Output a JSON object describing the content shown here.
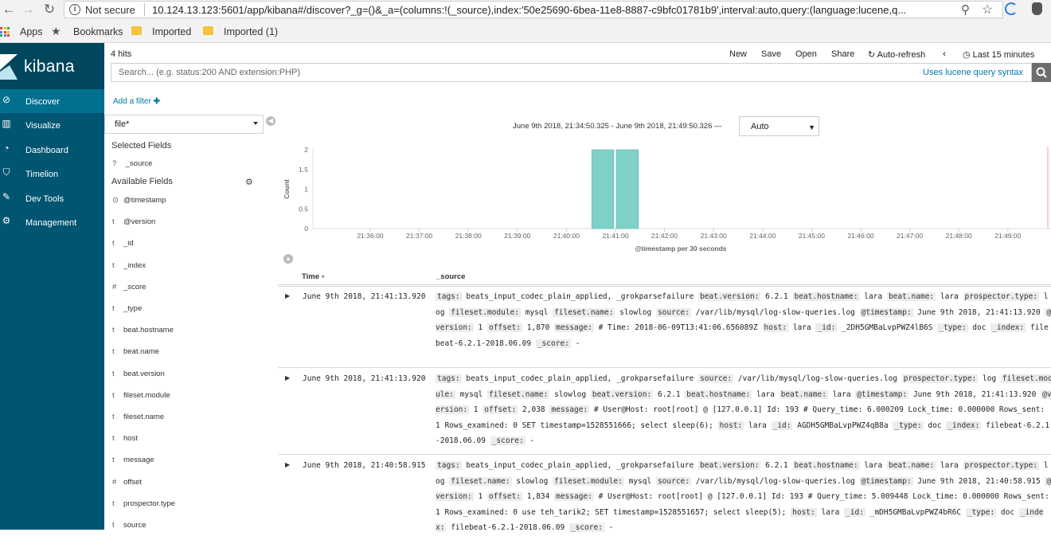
{
  "browser": {
    "not_secure": "Not secure",
    "url": "10.124.13.123:5601/app/kibana#/discover?_g=()&_a=(columns:!(_source),index:'50e25690-6bea-11e8-8887-c9bfc01781b9',interval:auto,query:(language:lucene,q...",
    "bookmarks": [
      "Apps",
      "Bookmarks",
      "Imported",
      "Imported (1)"
    ]
  },
  "kibana": {
    "logo": "kibana",
    "nav": [
      "Discover",
      "Visualize",
      "Dashboard",
      "Timelion",
      "Dev Tools",
      "Management"
    ],
    "active_nav": "Discover"
  },
  "top": {
    "hits": "4 hits",
    "actions": [
      "New",
      "Save",
      "Open",
      "Share",
      "Auto-refresh",
      "Last 15 minutes"
    ]
  },
  "search": {
    "placeholder": "Search... (e.g. status:200 AND extension:PHP)",
    "syntax_link": "Uses lucene query syntax"
  },
  "add_filter": "Add a filter",
  "index_pattern": "file*",
  "fields": {
    "selected_title": "Selected Fields",
    "selected": [
      {
        "type": "?",
        "name": "_source"
      }
    ],
    "available_title": "Available Fields",
    "available": [
      {
        "type": "⊙",
        "name": "@timestamp"
      },
      {
        "type": "t",
        "name": "@version"
      },
      {
        "type": "t",
        "name": "_id"
      },
      {
        "type": "t",
        "name": "_index"
      },
      {
        "type": "#",
        "name": "_score"
      },
      {
        "type": "t",
        "name": "_type"
      },
      {
        "type": "t",
        "name": "beat.hostname"
      },
      {
        "type": "t",
        "name": "beat.name"
      },
      {
        "type": "t",
        "name": "beat.version"
      },
      {
        "type": "t",
        "name": "fileset.module"
      },
      {
        "type": "t",
        "name": "fileset.name"
      },
      {
        "type": "t",
        "name": "host"
      },
      {
        "type": "t",
        "name": "message"
      },
      {
        "type": "#",
        "name": "offset"
      },
      {
        "type": "t",
        "name": "prospector.type"
      },
      {
        "type": "t",
        "name": "source"
      }
    ]
  },
  "time_range": "June 9th 2018, 21:34:50.325 - June 9th 2018, 21:49:50.326 —",
  "interval": "Auto",
  "chart_data": {
    "type": "bar",
    "categories": [
      "21:40:30",
      "21:41:00"
    ],
    "values": [
      2,
      2
    ],
    "ylabel": "Count",
    "xlabel": "@timestamp per 30 seconds",
    "ylim": [
      0,
      2
    ],
    "yticks": [
      "2",
      "1.5",
      "1",
      "0.5",
      "0"
    ],
    "xticks": [
      "21:36:00",
      "21:37:00",
      "21:38:00",
      "21:39:00",
      "21:40:00",
      "21:41:00",
      "21:42:00",
      "21:43:00",
      "21:44:00",
      "21:45:00",
      "21:46:00",
      "21:47:00",
      "21:48:00",
      "21:49:00"
    ],
    "bar_color": "#7fd1c7",
    "grid": false
  },
  "table": {
    "headers": [
      "Time",
      "_source"
    ],
    "rows": [
      {
        "time": "June 9th 2018, 21:41:13.920",
        "source": [
          [
            "tags:",
            "beats_input_codec_plain_applied, _grokparsefailure"
          ],
          [
            "beat.version:",
            "6.2.1"
          ],
          [
            "beat.hostname:",
            "lara"
          ],
          [
            "beat.name:",
            "lara"
          ],
          [
            "prospector.type:",
            "log"
          ],
          [
            "fileset.module:",
            "mysql"
          ],
          [
            "fileset.name:",
            "slowlog"
          ],
          [
            "source:",
            "/var/lib/mysql/log-slow-queries.log"
          ],
          [
            "@timestamp:",
            "June 9th 2018, 21:41:13.920"
          ],
          [
            "@version:",
            "1"
          ],
          [
            "offset:",
            "1,870"
          ],
          [
            "message:",
            "# Time: 2018-06-09T13:41:06.656089Z"
          ],
          [
            "host:",
            "lara"
          ],
          [
            "_id:",
            "_2DH5GMBaLvpPWZ4lB6S"
          ],
          [
            "_type:",
            "doc"
          ],
          [
            "_index:",
            "filebeat-6.2.1-2018.06.09"
          ],
          [
            "_score:",
            "-"
          ]
        ]
      },
      {
        "time": "June 9th 2018, 21:41:13.920",
        "source": [
          [
            "tags:",
            "beats_input_codec_plain_applied, _grokparsefailure"
          ],
          [
            "source:",
            "/var/lib/mysql/log-slow-queries.log"
          ],
          [
            "prospector.type:",
            "log"
          ],
          [
            "fileset.module:",
            "mysql"
          ],
          [
            "fileset.name:",
            "slowlog"
          ],
          [
            "beat.version:",
            "6.2.1"
          ],
          [
            "beat.hostname:",
            "lara"
          ],
          [
            "beat.name:",
            "lara"
          ],
          [
            "@timestamp:",
            "June 9th 2018, 21:41:13.920"
          ],
          [
            "@version:",
            "1"
          ],
          [
            "offset:",
            "2,038"
          ],
          [
            "message:",
            "# User@Host: root[root] @ [127.0.0.1] Id: 193 # Query_time: 6.000209 Lock_time: 0.000000 Rows_sent: 1 Rows_examined: 0 SET timestamp=1528551666; select sleep(6);"
          ],
          [
            "host:",
            "lara"
          ],
          [
            "_id:",
            "AGDH5GMBaLvpPWZ4qB8a"
          ],
          [
            "_type:",
            "doc"
          ],
          [
            "_index:",
            "filebeat-6.2.1-2018.06.09"
          ],
          [
            "_score:",
            "-"
          ]
        ]
      },
      {
        "time": "June 9th 2018, 21:40:58.915",
        "source": [
          [
            "tags:",
            "beats_input_codec_plain_applied, _grokparsefailure"
          ],
          [
            "beat.version:",
            "6.2.1"
          ],
          [
            "beat.hostname:",
            "lara"
          ],
          [
            "beat.name:",
            "lara"
          ],
          [
            "prospector.type:",
            "log"
          ],
          [
            "fileset.name:",
            "slowlog"
          ],
          [
            "fileset.module:",
            "mysql"
          ],
          [
            "source:",
            "/var/lib/mysql/log-slow-queries.log"
          ],
          [
            "@timestamp:",
            "June 9th 2018, 21:40:58.915"
          ],
          [
            "@version:",
            "1"
          ],
          [
            "offset:",
            "1,834"
          ],
          [
            "message:",
            "# User@Host: root[root] @ [127.0.0.1] Id: 193 # Query_time: 5.009448 Lock_time: 0.000000 Rows_sent: 1 Rows_examined: 0 use teh_tarik2; SET timestamp=1528551657; select sleep(5);"
          ],
          [
            "host:",
            "lara"
          ],
          [
            "_id:",
            "_mDH5GMBaLvpPWZ4bR6C"
          ],
          [
            "_type:",
            "doc"
          ],
          [
            "_index:",
            "filebeat-6.2.1-2018.06.09"
          ],
          [
            "_score:",
            "-"
          ]
        ]
      }
    ]
  }
}
